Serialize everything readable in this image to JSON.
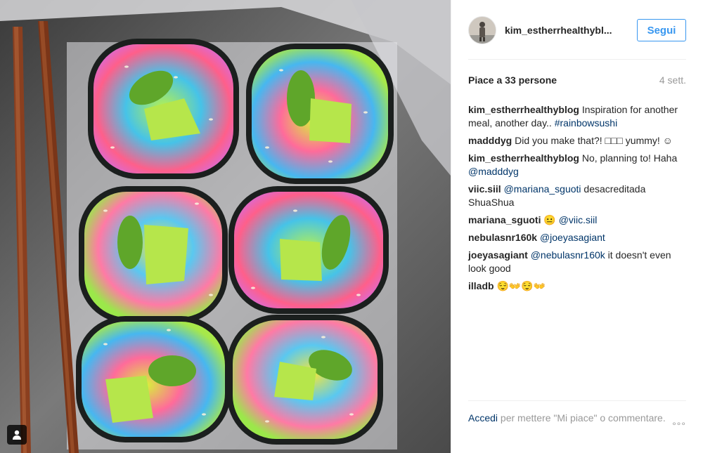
{
  "header": {
    "username": "kim_estherrhealthybl...",
    "follow_label": "Segui"
  },
  "stats": {
    "likes": "Piace a 33 persone",
    "time": "4 sett."
  },
  "comments": [
    {
      "user": "kim_estherrhealthyblog",
      "text": " Inspiration for another meal, another day.. ",
      "link": "#rainbowsushi",
      "after": ""
    },
    {
      "user": "madddyg",
      "text": " Did you make that?! □□□ yummy! ☺",
      "link": "",
      "after": ""
    },
    {
      "user": "kim_estherrhealthyblog",
      "text": " No, planning to! Haha ",
      "link": "@madddyg",
      "after": ""
    },
    {
      "user": "viic.siil",
      "text": " ",
      "link": "@mariana_sguoti",
      "after": " desacreditada ShuaShua"
    },
    {
      "user": "mariana_sguoti",
      "text": " 😐 ",
      "link": "@viic.siil",
      "after": ""
    },
    {
      "user": "nebulasnr160k",
      "text": " ",
      "link": "@joeyasagiant",
      "after": ""
    },
    {
      "user": "joeyasagiant",
      "text": " ",
      "link": "@nebulasnr160k",
      "after": " it doesn't even look good"
    },
    {
      "user": "illadb",
      "text": " 😌👐😌👐",
      "link": "",
      "after": ""
    }
  ],
  "footer": {
    "login_link": "Accedi",
    "login_text": " per mettere \"Mi piace\" o commentare."
  },
  "more_label": "°°°",
  "icons": {
    "user_tag": "person-icon",
    "more": "more-options-icon"
  },
  "colors": {
    "accent": "#3897f0",
    "link": "#003569",
    "muted": "#999999"
  }
}
